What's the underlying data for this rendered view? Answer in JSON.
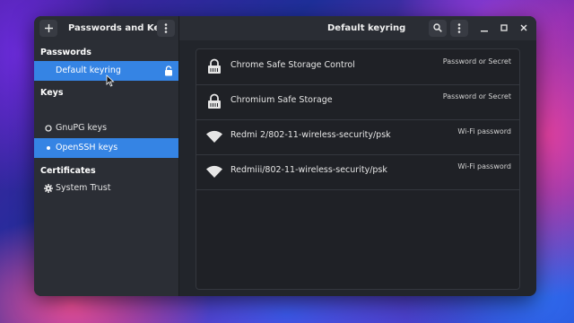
{
  "window": {
    "app_title": "Passwords and Keys",
    "view_title": "Default keyring"
  },
  "headerbar": {
    "new_button_icon": "plus-icon",
    "menu_icon": "vertical-dots-icon",
    "search_icon": "search-icon",
    "window_buttons": [
      "minimize",
      "maximize",
      "close"
    ]
  },
  "sidebar": {
    "sections": [
      {
        "heading": "Passwords",
        "items": [
          {
            "label": "Default keyring",
            "icon": "lock-icon",
            "selected": true
          }
        ]
      },
      {
        "heading": "Keys",
        "items": [
          {
            "label": "GnuPG keys",
            "icon": "circle-icon",
            "selected": false
          },
          {
            "label": "OpenSSH keys",
            "icon": "dot-icon",
            "selected": true
          }
        ]
      },
      {
        "heading": "Certificates",
        "items": [
          {
            "label": "System Trust",
            "icon": "gear-icon",
            "selected": false
          }
        ]
      }
    ]
  },
  "items": [
    {
      "name": "Chrome Safe Storage Control",
      "type": "Password or Secret",
      "icon": "keyring-icon"
    },
    {
      "name": "Chromium Safe Storage",
      "type": "Password or Secret",
      "icon": "keyring-icon"
    },
    {
      "name": "Redmi 2/802-11-wireless-security/psk",
      "type": "Wi-Fi password",
      "icon": "wifi-icon"
    },
    {
      "name": "Redmiii/802-11-wireless-security/psk",
      "type": "Wi-Fi password",
      "icon": "wifi-icon"
    }
  ],
  "colors": {
    "accent": "#3584e4",
    "window_bg": "#22252b",
    "sidebar_bg": "#2b2e35"
  }
}
